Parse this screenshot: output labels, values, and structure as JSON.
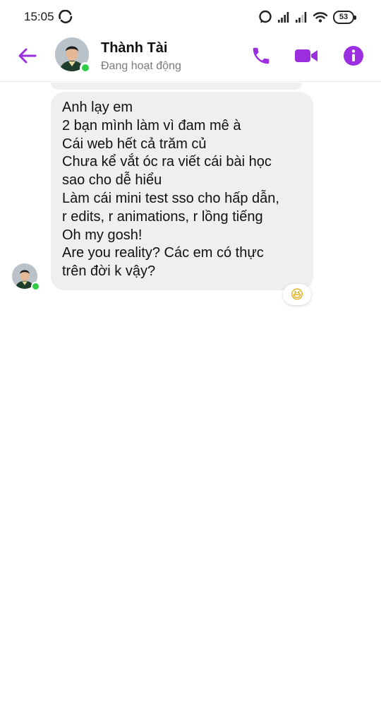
{
  "status_bar": {
    "time": "15:05",
    "battery": "53",
    "icons": [
      "sync-icon",
      "whatsapp-icon",
      "signal-1-icon",
      "signal-2-icon",
      "wifi-icon",
      "battery-icon"
    ]
  },
  "header": {
    "contact_name": "Thành Tài",
    "contact_status": "Đang hoạt động",
    "accent_color": "#9b2fe0",
    "online_color": "#31cc46",
    "icons": [
      "back-arrow-icon",
      "phone-icon",
      "video-camera-icon",
      "info-icon"
    ]
  },
  "conversation": {
    "bubble_color": "#efefef",
    "message": {
      "lines": [
        "Anh lạy em",
        "2 bạn mình làm vì đam mê à",
        "Cái web hết cả trăm củ",
        "Chưa kể vắt óc ra viết cái bài học",
        "sao cho dễ hiểu",
        "Làm cái mini test sso cho hấp dẫn,",
        "r edits, r animations, r lồng tiếng",
        "Oh my gosh!",
        "Are you reality? Các em có thực",
        "trên đời k vậy?"
      ],
      "reaction": "😆"
    }
  }
}
